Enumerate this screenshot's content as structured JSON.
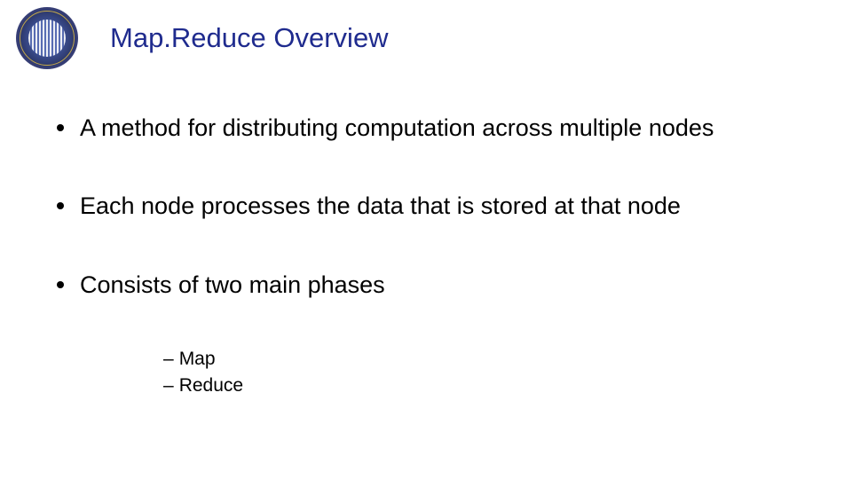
{
  "title": "Map.Reduce Overview",
  "bullets": [
    {
      "text": "A method for distributing computation across multiple nodes"
    },
    {
      "text": "Each node processes the data that is stored at that node"
    },
    {
      "text": "Consists of two main phases"
    }
  ],
  "sub_items": [
    {
      "text": "Map"
    },
    {
      "text": "Reduce"
    }
  ]
}
